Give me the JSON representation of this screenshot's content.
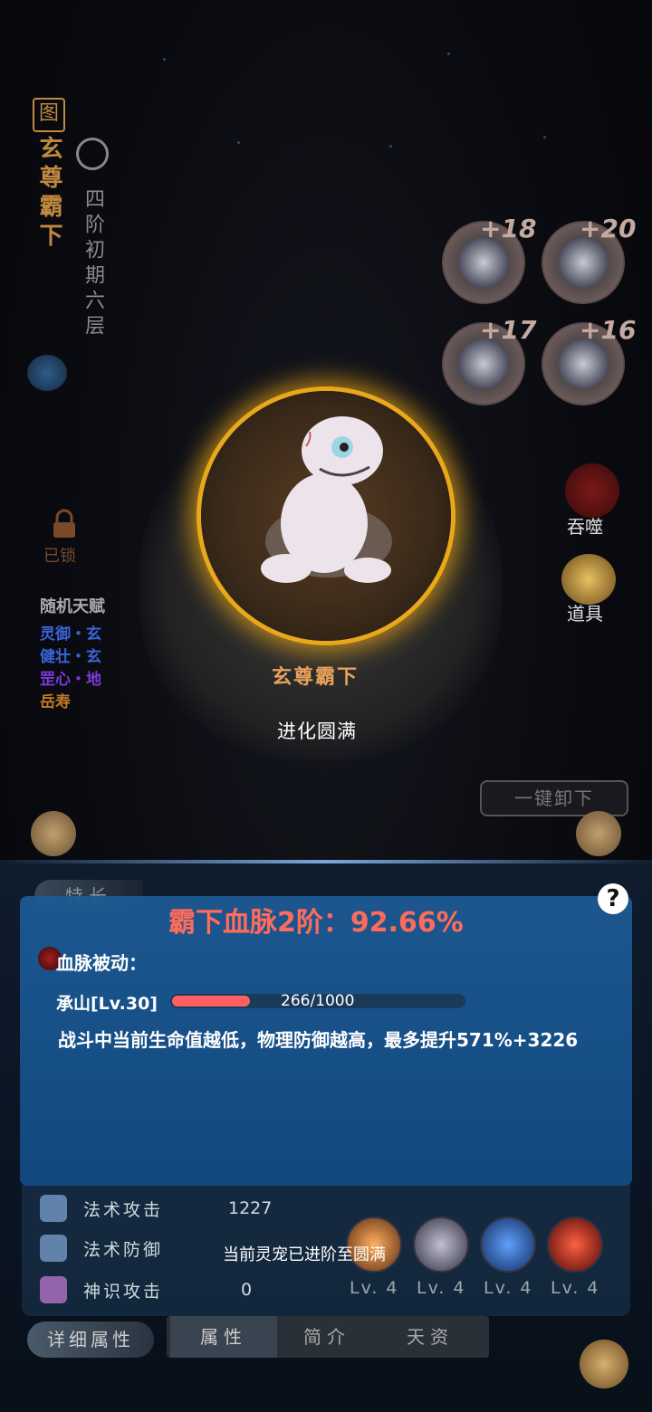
{
  "pet": {
    "name_vertical": "玄尊霸下",
    "seal_char": "图",
    "stage_vertical": "四阶初期六层",
    "name": "玄尊霸下",
    "status": "进化圆满"
  },
  "lock_label": "已锁",
  "talents": {
    "title": "随机天赋",
    "items": [
      {
        "text": "灵御・玄",
        "color": "#3a64d8"
      },
      {
        "text": "健壮・玄",
        "color": "#3a64d8"
      },
      {
        "text": "罡心・地",
        "color": "#7a3ad8"
      },
      {
        "text": "岳寿",
        "color": "#c07a2a"
      }
    ]
  },
  "equipment": [
    {
      "icon": "shoulder-armor-icon",
      "plus": "+18"
    },
    {
      "icon": "helmet-icon",
      "plus": "+20"
    },
    {
      "icon": "bracer-icon",
      "plus": "+17"
    },
    {
      "icon": "belt-icon",
      "plus": "+16"
    }
  ],
  "side_buttons": {
    "devour": "吞噬",
    "items": "道具"
  },
  "unequip_all": "一键卸下",
  "panel": {
    "tab_special": "特长",
    "help": "?"
  },
  "bloodline": {
    "title": "霸下血脉2阶：92.66%",
    "passive_label": "血脉被动：",
    "skill": "承山[Lv.30]",
    "progress_text": "266/1000",
    "progress_fraction": 0.266,
    "description": "战斗中当前生命值越低，物理防御越高，最多提升571%+3226"
  },
  "stats": [
    {
      "label": "法术攻击",
      "value": "1227"
    },
    {
      "label": "法术防御",
      "value": ""
    },
    {
      "label": "神识攻击",
      "value": "0"
    }
  ],
  "skills": [
    {
      "level": "Lv. 4",
      "color": "#c05a1a"
    },
    {
      "level": "Lv. 4",
      "color": "#8a8aa0"
    },
    {
      "level": "Lv. 4",
      "color": "#2a6ad0"
    },
    {
      "level": "Lv. 4",
      "color": "#a02a1a"
    }
  ],
  "note": "当前灵宠已进阶至圆满",
  "bottom": {
    "detail": "详细属性",
    "tabs": [
      "属性",
      "简介",
      "天资"
    ]
  }
}
